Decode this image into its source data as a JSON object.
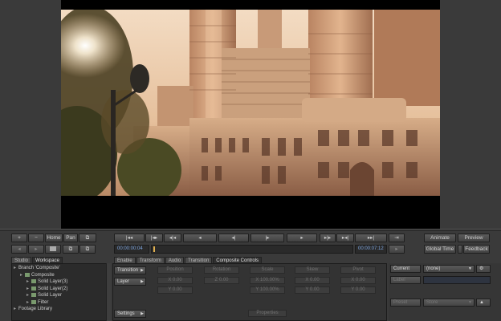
{
  "viewer": {
    "image_name": "city-street-sunset-frame"
  },
  "toolbar": {
    "plus": "+",
    "minus": "−",
    "home": "Home",
    "pan": "Pan",
    "frame_glyph": "⧉",
    "back": "◂",
    "forward": "▸",
    "transport": [
      "|◂◂",
      "|◂▸",
      "◂|◂",
      "◂",
      "◂|",
      "|▸",
      "▸",
      "▸|▸",
      "▸◂|",
      "▸▸|",
      "⇥"
    ],
    "timecode_start": "00:00:00:04",
    "timecode_end": "00:00:07:12",
    "animate": "Animate",
    "preview": "Preview",
    "global_time": "Global Time",
    "feedback": "Feedback"
  },
  "left_tabs": [
    "Studio",
    "Workspace"
  ],
  "tree": [
    {
      "label": "Branch 'Composite'",
      "level": 0
    },
    {
      "label": "Composite",
      "level": 1
    },
    {
      "label": "Solid Layer(3)",
      "level": 2
    },
    {
      "label": "Solid Layer(2)",
      "level": 2
    },
    {
      "label": "Solid Layer",
      "level": 2
    },
    {
      "label": "Filter",
      "level": 2
    },
    {
      "label": "Footage Library",
      "level": 0
    }
  ],
  "right_tabs": [
    "Enable",
    "Transform",
    "Audio",
    "Transition",
    "Composite Controls"
  ],
  "controls": {
    "transition": "Transition",
    "layer": "Layer",
    "settings": "Settings",
    "col_headers": [
      "Position",
      "Rotation",
      "Scale",
      "Skew",
      "Pivot"
    ],
    "values": {
      "pos_x": "X 0.00",
      "pos_y": "Y 0.00",
      "rot": "Z 0.00",
      "scale_x": "X 100.00%",
      "scale_y": "Y 100.00%",
      "skew_x": "X 0.00",
      "skew_y": "Y 0.00",
      "pivot_x": "X 0.00",
      "pivot_y": "Y 0.00"
    },
    "properties": "Properties"
  },
  "right": {
    "current": "Current",
    "none": "(none)",
    "label": "Label",
    "preset": "Preset",
    "store": "Store"
  }
}
